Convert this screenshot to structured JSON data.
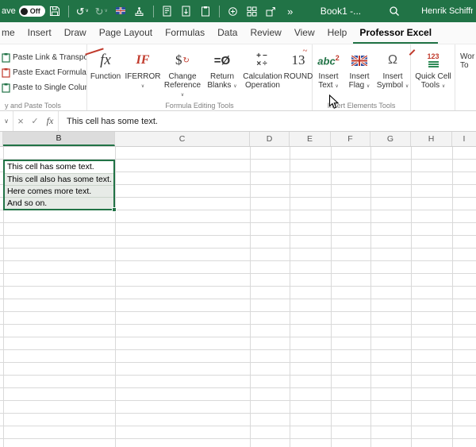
{
  "titlebar": {
    "autosave_label": "ave",
    "autosave_state": "Off",
    "workbook_title": "Book1 -...",
    "user_name": "Henrik Schiffner",
    "overflow_glyph": "»"
  },
  "glyphs": {
    "undo": "↺",
    "redo": "↻",
    "chevron": "∨",
    "cancel": "×",
    "check": "✓",
    "fx": "fx"
  },
  "tabs": [
    {
      "label": "me"
    },
    {
      "label": "Insert"
    },
    {
      "label": "Draw"
    },
    {
      "label": "Page Layout"
    },
    {
      "label": "Formulas"
    },
    {
      "label": "Data"
    },
    {
      "label": "Review"
    },
    {
      "label": "View"
    },
    {
      "label": "Help"
    },
    {
      "label": "Professor Excel"
    }
  ],
  "ribbon": {
    "paste_group": {
      "label": "y and Paste Tools",
      "items": [
        {
          "label": "Paste Link & Transpose"
        },
        {
          "label": "Paste Exact Formula"
        },
        {
          "label": "Paste to Single Column"
        }
      ]
    },
    "formula_group": {
      "label": "Formula Editing Tools",
      "buttons": [
        {
          "label": "Function"
        },
        {
          "label": "IFERROR"
        },
        {
          "label": "Change Reference"
        },
        {
          "label": "Return Blanks"
        },
        {
          "label": "Calculation Operation"
        },
        {
          "label": "ROUND"
        }
      ]
    },
    "insert_group": {
      "label": "Insert Elements Tools",
      "buttons": [
        {
          "label": "Insert Text"
        },
        {
          "label": "Insert Flag"
        },
        {
          "label": "Insert Symbol"
        }
      ]
    },
    "quick_group": {
      "button_label": "Quick Cell Tools",
      "partial_line1": "Wor",
      "partial_line2": "To"
    },
    "icon_text": {
      "function": "fx",
      "iferror": "IF",
      "change_reference": "$",
      "change_reference_arrow": "↻",
      "return_blanks": "=Ø",
      "calc_top": "+−",
      "calc_bottom": "×÷",
      "round_num": "13",
      "round_tilde": "~",
      "insert_text_abc": "abc",
      "insert_text_sup": "2",
      "insert_symbol": "Ω",
      "quick_123": "123"
    }
  },
  "formula_bar": {
    "value": "This cell has some text."
  },
  "sheet": {
    "columns": [
      "B",
      "C",
      "D",
      "E",
      "F",
      "G",
      "H",
      "I"
    ],
    "cells": [
      "This cell has some text.",
      "This cell also has some text.",
      "Here comes more text.",
      "And so on."
    ]
  },
  "colors": {
    "excel_green": "#217346"
  }
}
